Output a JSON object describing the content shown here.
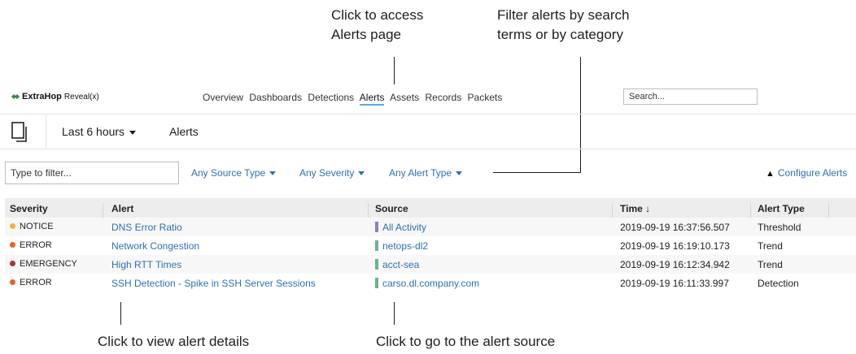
{
  "callouts": {
    "alerts_page": [
      "Click to access",
      "Alerts page"
    ],
    "filter": [
      "Filter alerts by search",
      "terms or by category"
    ],
    "details": "Click to view alert details",
    "source": "Click to go to the alert source"
  },
  "nav": {
    "brand": "ExtraHop",
    "product": "Reveal(x)",
    "links": [
      "Overview",
      "Dashboards",
      "Detections",
      "Alerts",
      "Assets",
      "Records",
      "Packets"
    ],
    "active": "Alerts",
    "search_placeholder": "Search..."
  },
  "timebar": {
    "icon": "copy-pages-icon",
    "time_range": "Last 6 hours",
    "page_title": "Alerts"
  },
  "filters": {
    "input_placeholder": "Type to filter...",
    "source_type": "Any Source Type",
    "severity": "Any Severity",
    "alert_type": "Any Alert Type",
    "configure": "Configure Alerts"
  },
  "table": {
    "headers": [
      "Severity",
      "Alert",
      "Source",
      "Time ↓",
      "Alert Type"
    ],
    "rows": [
      {
        "severity": "NOTICE",
        "alert": "DNS Error Ratio",
        "source": "All Activity",
        "time": "2019-09-19 16:37:56.507",
        "type": "Threshold"
      },
      {
        "severity": "ERROR",
        "alert": "Network Congestion",
        "source": "netops-dl2",
        "time": "2019-09-19 16:19:10.173",
        "type": "Trend"
      },
      {
        "severity": "EMERGENCY",
        "alert": "High RTT Times",
        "source": "acct-sea",
        "time": "2019-09-19 16:12:34.942",
        "type": "Trend"
      },
      {
        "severity": "ERROR",
        "alert": "SSH Detection - Spike in SSH Server Sessions",
        "source": "carso.dl.company.com",
        "time": "2019-09-19 16:11:33.997",
        "type": "Detection"
      }
    ]
  },
  "colors": {
    "notice": "#f2b233",
    "error": "#e8602c",
    "emergency": "#a8323a",
    "source_all": "#8b7fc9",
    "source_device": "#6cb38a",
    "link": "#2f6fb3"
  }
}
